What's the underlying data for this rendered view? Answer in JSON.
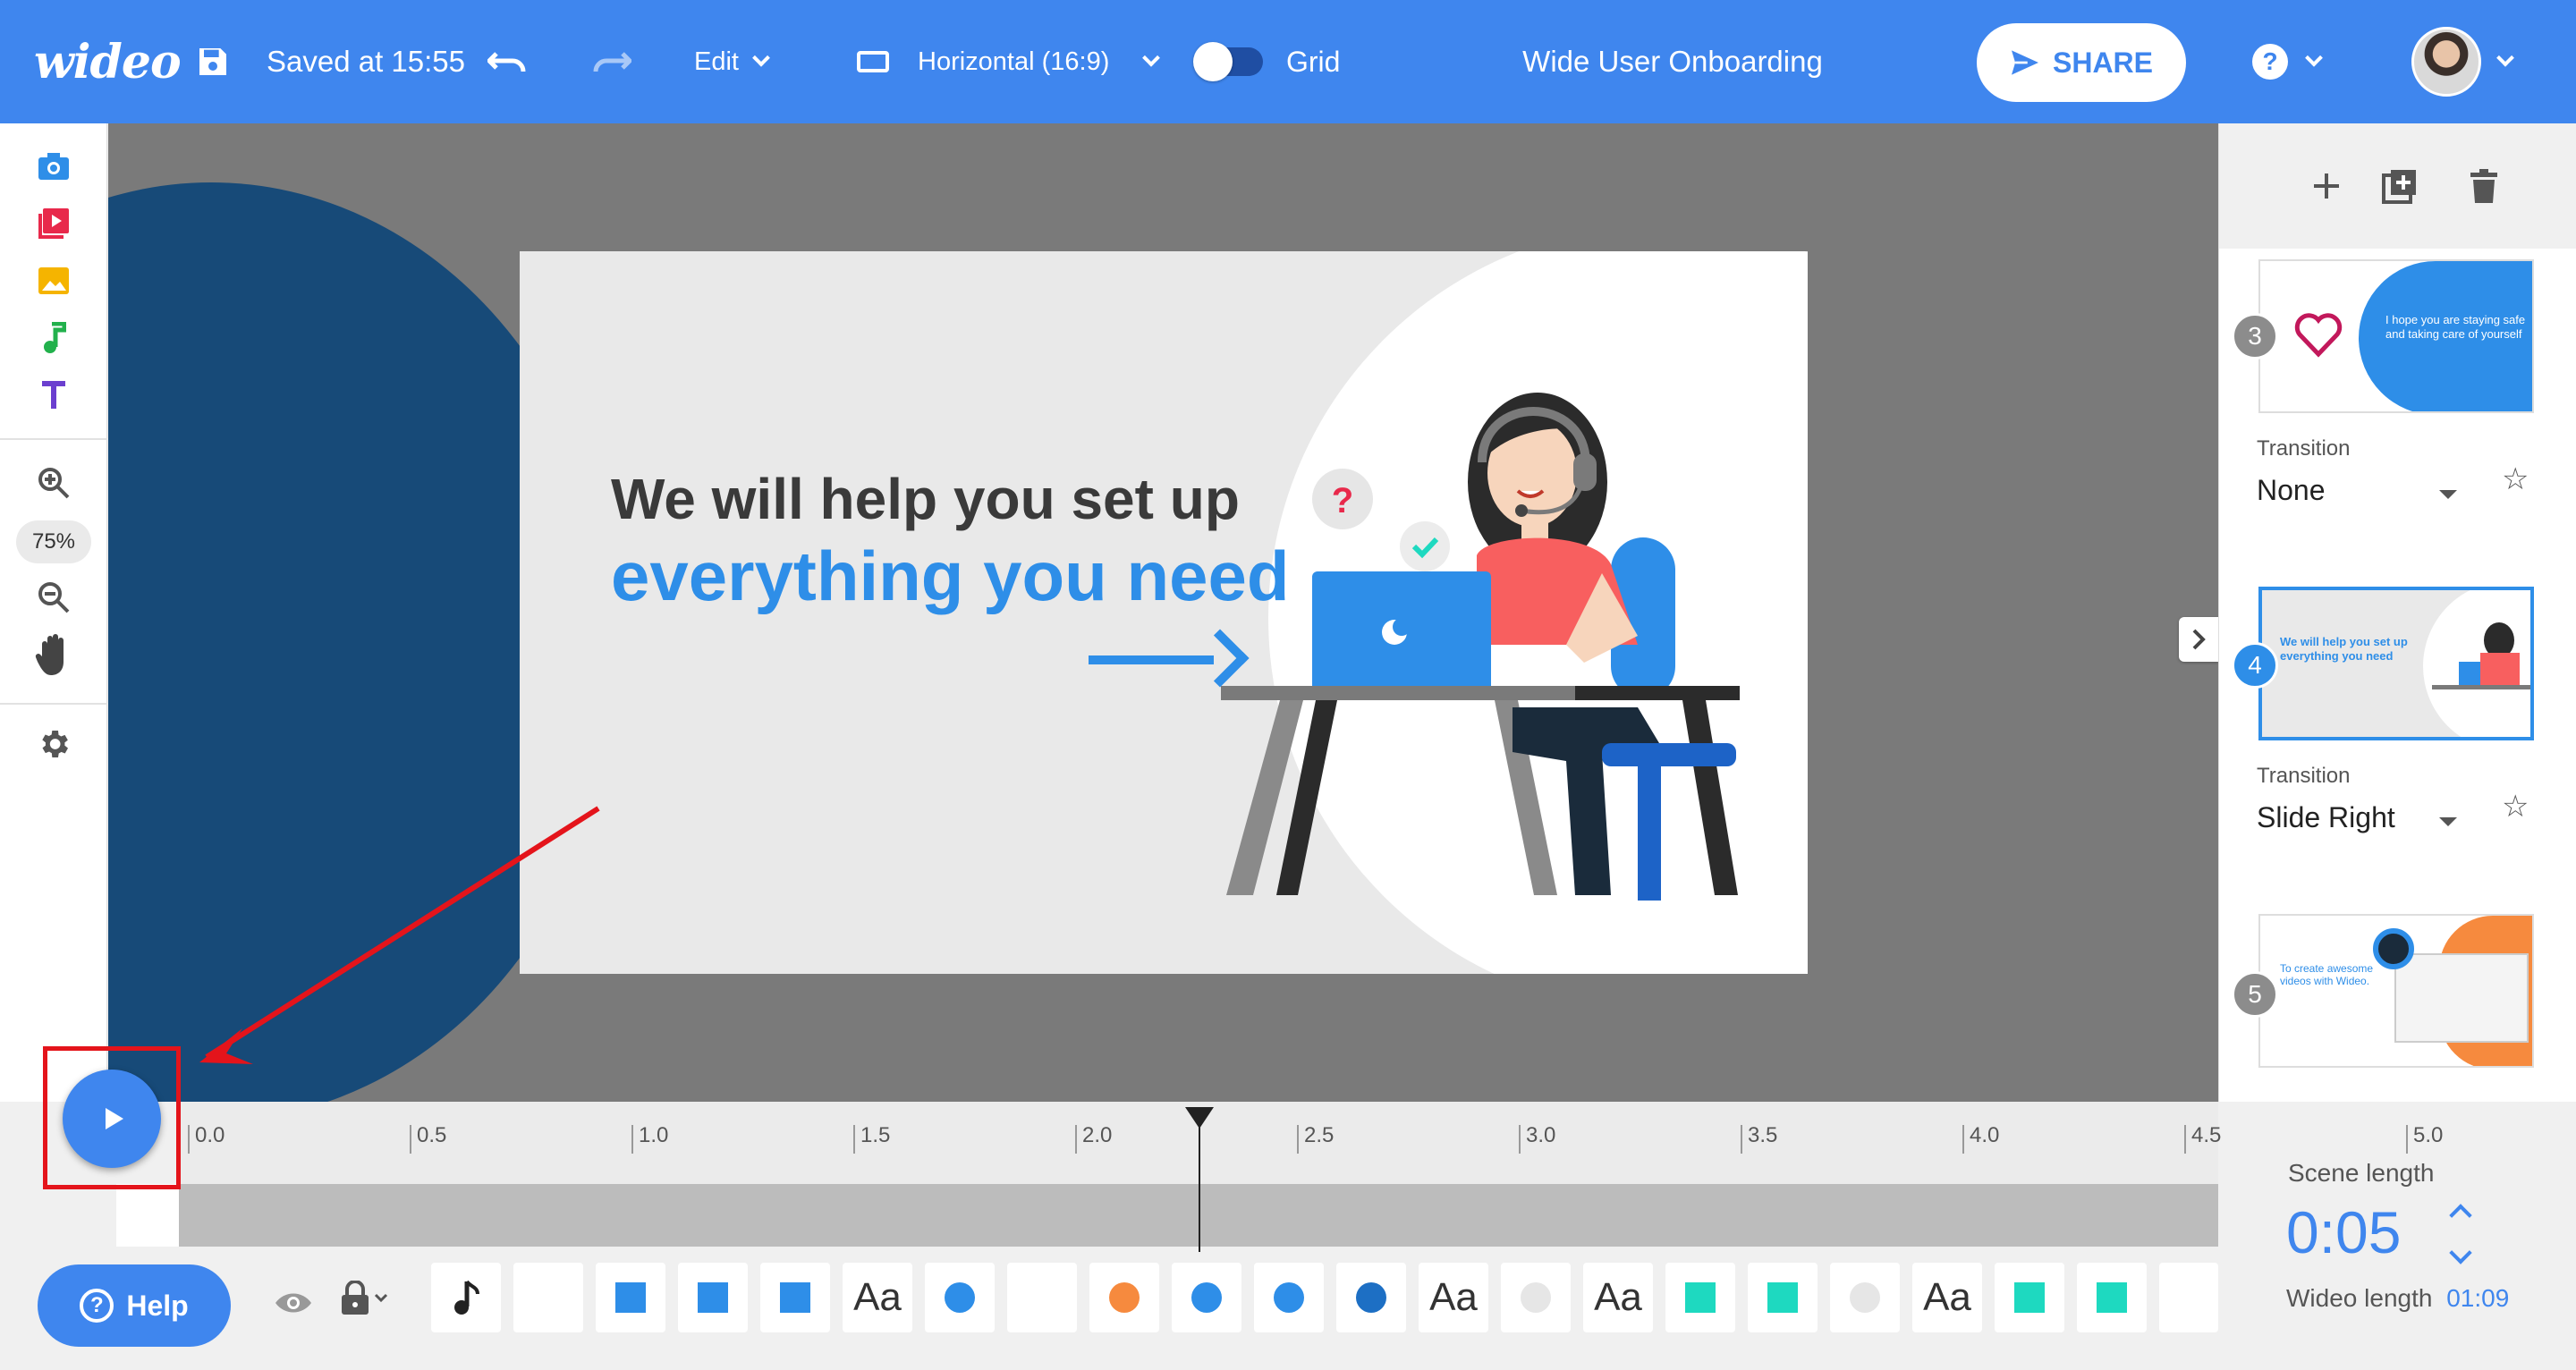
{
  "topbar": {
    "logo": "wideo",
    "saved_text": "Saved at 15:55",
    "edit_label": "Edit",
    "format_label": "Horizontal (16:9)",
    "grid_label": "Grid",
    "project_title": "Wide User Onboarding",
    "share_label": "SHARE",
    "help_glyph": "?"
  },
  "left_toolbar": {
    "zoom_level": "75%"
  },
  "scene": {
    "headline_line1": "We will help you set up",
    "headline_line2": "everything you need"
  },
  "right_panel": {
    "scenes": [
      {
        "number": "3",
        "transition_label": "Transition",
        "transition": "None",
        "thumb_text": "I hope you are staying safe and taking care of yourself"
      },
      {
        "number": "4",
        "transition_label": "Transition",
        "transition": "Slide Right",
        "thumb_text": "We will help you set up everything you need"
      },
      {
        "number": "5",
        "transition_label": "",
        "transition": "",
        "thumb_text": "To create awesome videos with Wideo."
      }
    ]
  },
  "timeline": {
    "ticks": [
      "0.0",
      "0.5",
      "1.0",
      "1.5",
      "2.0",
      "2.5",
      "3.0",
      "3.5",
      "4.0",
      "4.5",
      "5.0"
    ],
    "playhead_time": 2.5,
    "scene_length_label": "Scene length",
    "scene_length": "0:05",
    "wideo_length_label": "Wideo length",
    "wideo_length": "01:09",
    "help_label": "Help",
    "layer_text": "Aa"
  },
  "colors": {
    "brand_blue": "#3f86ee",
    "accent_blue": "#2e8ee8",
    "teal": "#1ed9c0",
    "orange": "#f68a3e",
    "highlight_red": "#e4141b"
  }
}
